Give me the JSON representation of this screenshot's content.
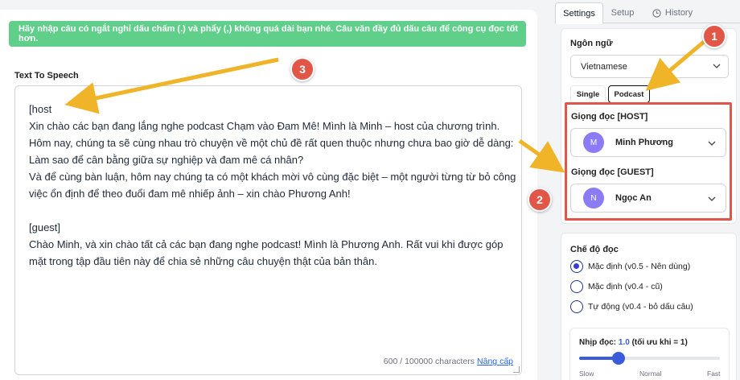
{
  "main": {
    "notice": "Hãy nhập câu có ngắt nghỉ dấu chấm (.) và phẩy (,) không quá dài bạn nhé. Câu văn đầy đủ dấu câu để công cụ đọc tốt hơn.",
    "tts_label": "Text To Speech",
    "text": "[host\nXin chào các bạn đang lắng nghe podcast Chạm vào Đam Mê! Mình là Minh – host của chương trình. Hôm nay, chúng ta sẽ cùng nhau trò chuyện về một chủ đề rất quen thuộc nhưng chưa bao giờ dễ dàng: Làm sao để cân bằng giữa sự nghiệp và đam mê cá nhân?\nVà để cùng bàn luận, hôm nay chúng ta có một khách mời vô cùng đặc biệt – một người từng từ bỏ công việc ổn định để theo đuổi đam mê nhiếp ảnh – xin chào Phương Anh!\n\n[guest]\nChào Minh, và xin chào tất cả các bạn đang nghe podcast! Mình là Phương Anh. Rất vui khi được góp mặt trong tập đầu tiên này để chia sẻ những câu chuyện thật của bản thân.",
    "char_count": "600 / 100000 characters",
    "upgrade_link": "Nâng cấp"
  },
  "tabs": [
    {
      "label": "Settings",
      "active": true
    },
    {
      "label": "Setup",
      "active": false
    },
    {
      "label": "History",
      "active": false
    }
  ],
  "language": {
    "label": "Ngôn ngữ",
    "selected": "Vietnamese"
  },
  "mode": {
    "single": "Single",
    "podcast": "Podcast",
    "selected": "Podcast"
  },
  "voices": {
    "host_label": "Giọng đọc [HOST]",
    "host_name": "Minh Phương",
    "host_initial": "M",
    "guest_label": "Giọng đọc [GUEST]",
    "guest_name": "Ngọc An",
    "guest_initial": "N"
  },
  "read_mode": {
    "label": "Chế độ đọc",
    "options": [
      {
        "label": "Mặc định (v0.5 - Nên dùng)",
        "checked": true
      },
      {
        "label": "Mặc định (v0.4 - cũ)",
        "checked": false
      },
      {
        "label": "Tự động (v0.4 - bỏ dấu câu)",
        "checked": false
      }
    ]
  },
  "speed": {
    "label": "Nhịp đọc:",
    "value": "1.0",
    "hint": "(tối ưu khi = 1)",
    "fraction": 0.28,
    "ticks": [
      "Slow",
      "Normal",
      "Fast"
    ]
  },
  "annotations": {
    "badge_1": "1",
    "badge_2": "2",
    "badge_3": "3"
  },
  "colors": {
    "notice_bg": "#5fcf8a",
    "highlight_border": "#e1564b",
    "arrow": "#f0b429",
    "accent": "#3b5bdb"
  }
}
